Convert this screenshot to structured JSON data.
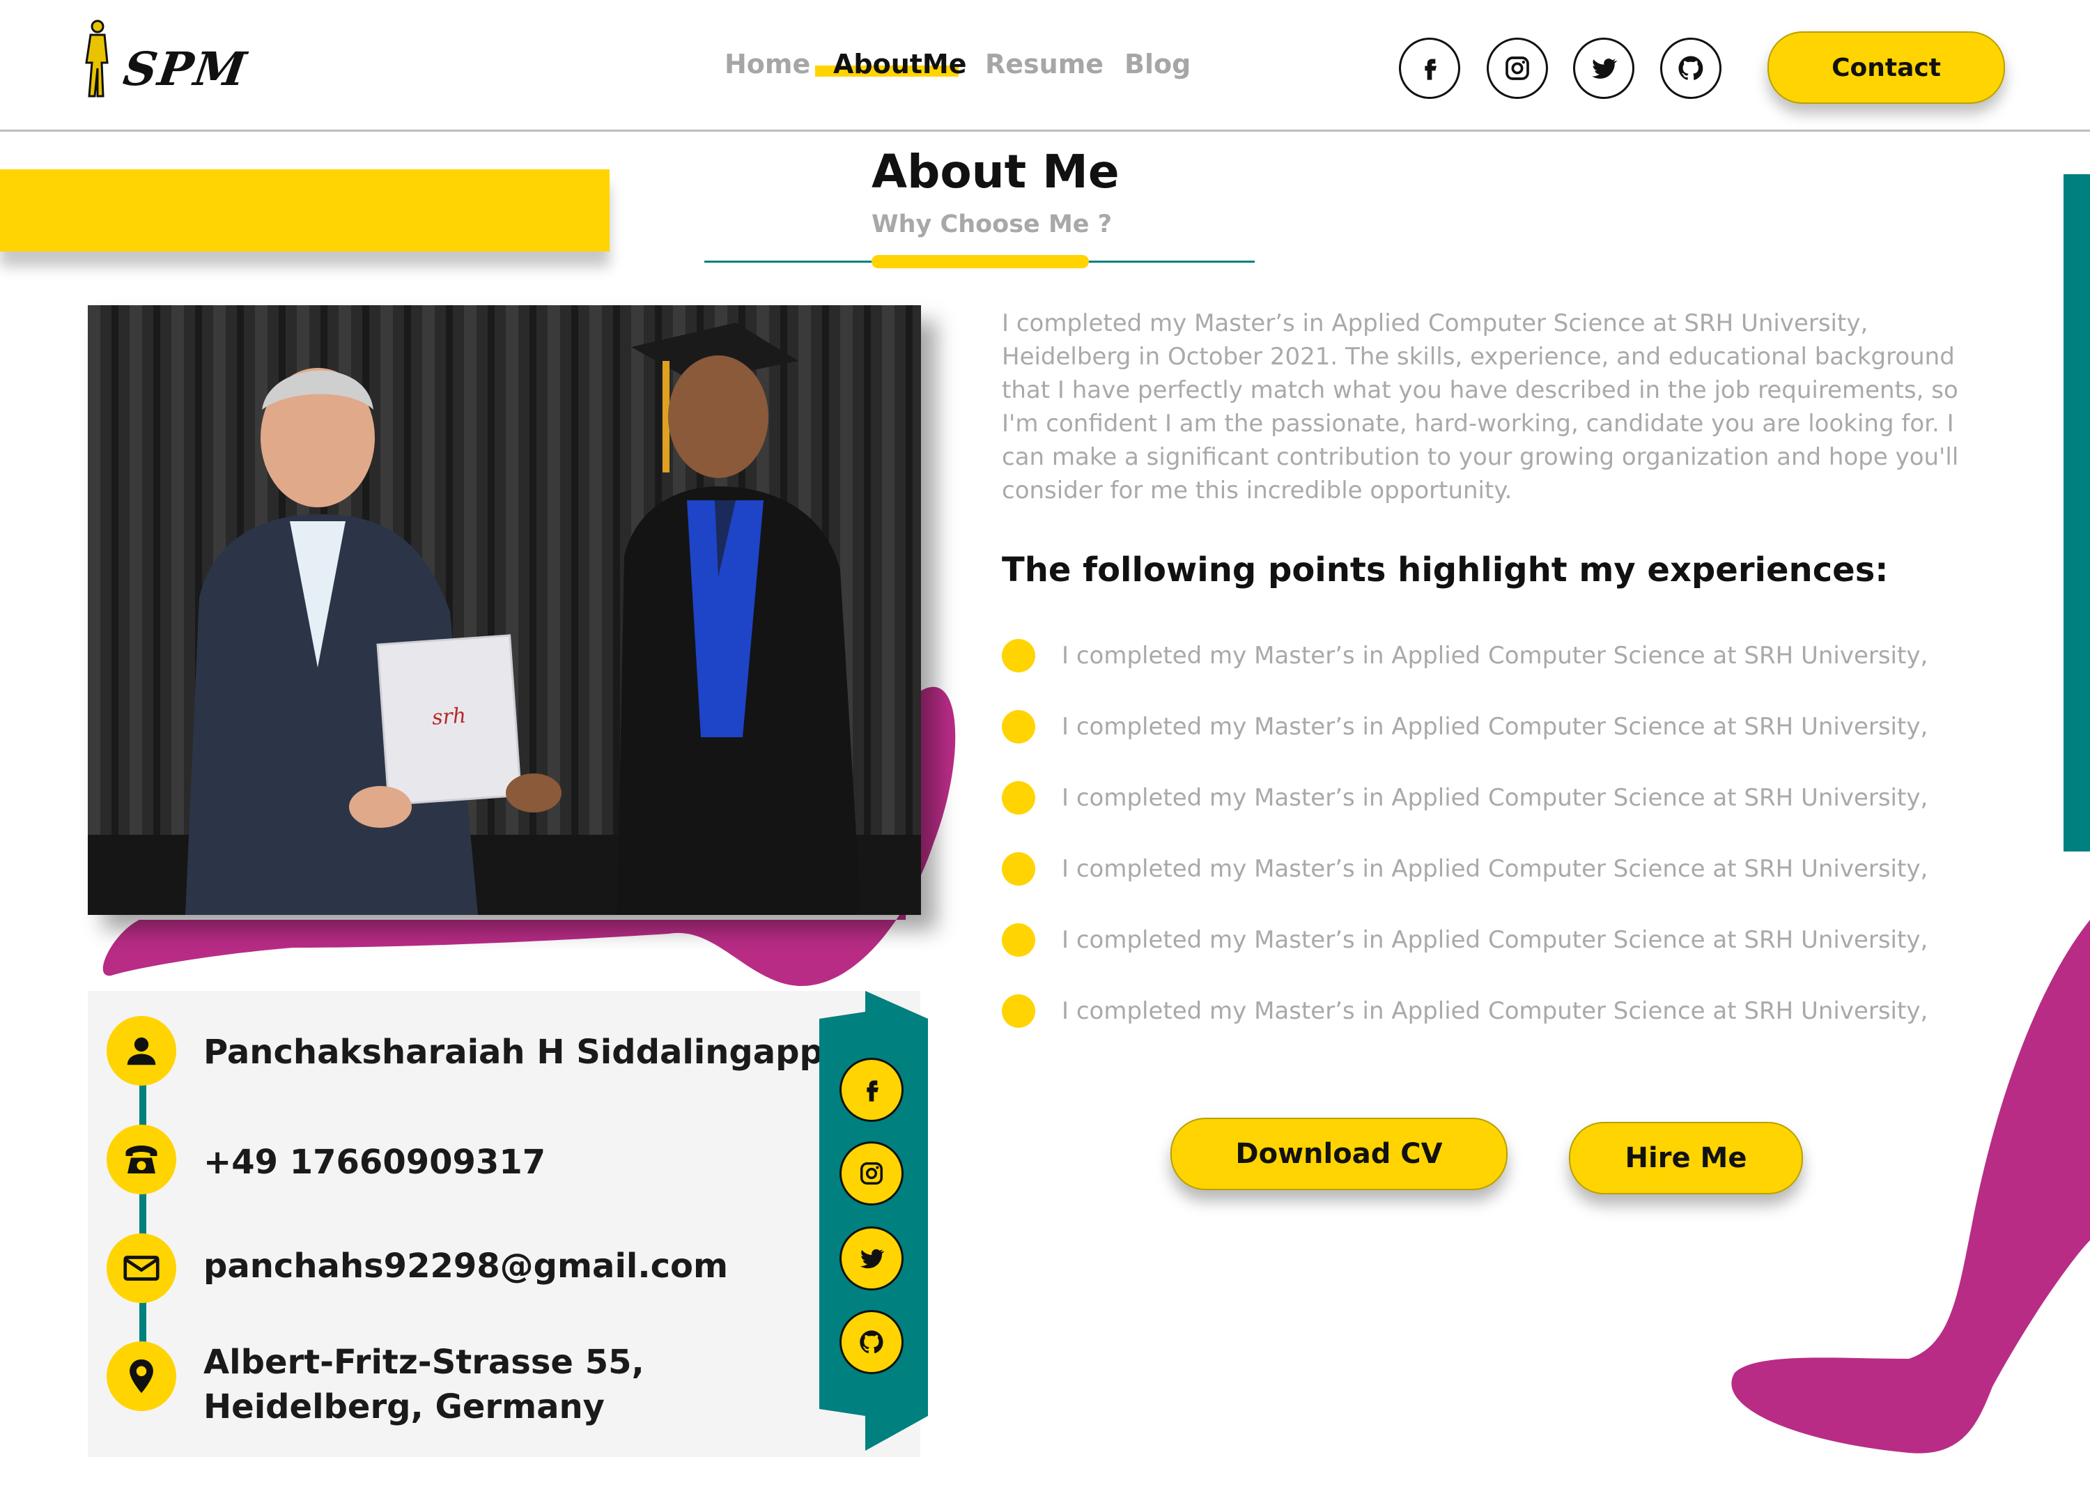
{
  "header": {
    "logo_text": "SPM",
    "nav": [
      {
        "label": "Home",
        "active": false
      },
      {
        "label": "AboutMe",
        "active": true
      },
      {
        "label": "Resume",
        "active": false
      },
      {
        "label": "Blog",
        "active": false
      }
    ],
    "social_icons": [
      "facebook-icon",
      "instagram-icon",
      "twitter-icon",
      "github-icon"
    ],
    "contact_label": "Contact"
  },
  "section": {
    "title": "About Me",
    "subtitle": "Why Choose Me ?"
  },
  "photo": {
    "folder_label": "srh"
  },
  "contact_info": {
    "name": "Panchaksharaiah H Siddalingappa",
    "phone": "+49 17660909317",
    "email": "panchahs92298@gmail.com",
    "address": "Albert-Fritz-Strasse 55, Heidelberg, Germany"
  },
  "about": {
    "paragraph": "I completed my Master’s in Applied Computer Science at SRH University, Heidelberg in October 2021. The skills, experience, and educational background that I have perfectly match what you have described in the job requirements, so I'm confident I am the passionate, hard-working, candidate you are looking for. I can make a significant contribution to your growing organization and hope you'll consider for me this incredible opportunity.",
    "points_heading": "The following points highlight my experiences:",
    "points": [
      "I completed my Master’s in Applied Computer Science at SRH University,",
      "I completed my Master’s in Applied Computer Science at SRH University,",
      "I completed my Master’s in Applied Computer Science at SRH University,",
      "I completed my Master’s in Applied Computer Science at SRH University,",
      "I completed my Master’s in Applied Computer Science at SRH University,",
      "I completed my Master’s in Applied Computer Science at SRH University,"
    ]
  },
  "actions": {
    "download_label": "Download CV",
    "hire_label": "Hire Me"
  },
  "colors": {
    "accent_yellow": "#FFD400",
    "teal": "#00807F",
    "magenta": "#B82C86",
    "muted_text": "#A9A9A9"
  }
}
